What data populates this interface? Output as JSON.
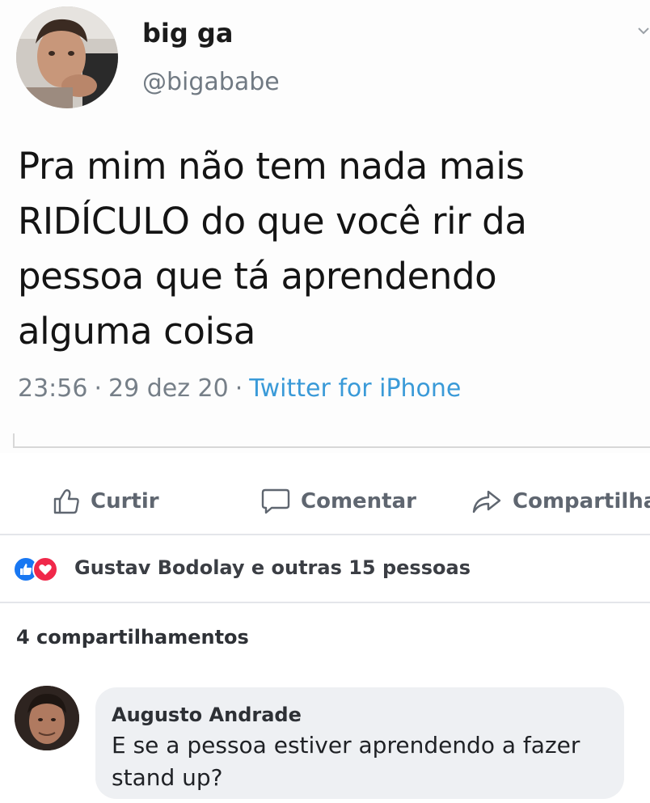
{
  "tweet": {
    "display_name": "big ga",
    "handle": "@bigababe",
    "text": "Pra mim não tem nada mais RIDÍCULO do que você rir da pessoa que tá aprendendo alguma coisa",
    "time": "23:56",
    "date": "29 dez 20",
    "separator": "·",
    "source": "Twitter for iPhone",
    "source_color": "#3a9ad8"
  },
  "post_actions": {
    "like_label": "Curtir",
    "comment_label": "Comentar",
    "share_label": "Compartilha",
    "like_icon": "thumbs-up-icon",
    "comment_icon": "speech-bubble-icon",
    "share_icon": "share-arrow-icon"
  },
  "reactions": {
    "icons": [
      "like-reaction-icon",
      "love-reaction-icon"
    ],
    "like_color": "#1877f2",
    "love_color": "#f0284a",
    "summary": "Gustav Bodolay e outras 15 pessoas"
  },
  "shares": {
    "label": "4 compartilhamentos"
  },
  "comment": {
    "author": "Augusto Andrade",
    "text": "E se a pessoa estiver aprendendo a fazer stand up?"
  }
}
